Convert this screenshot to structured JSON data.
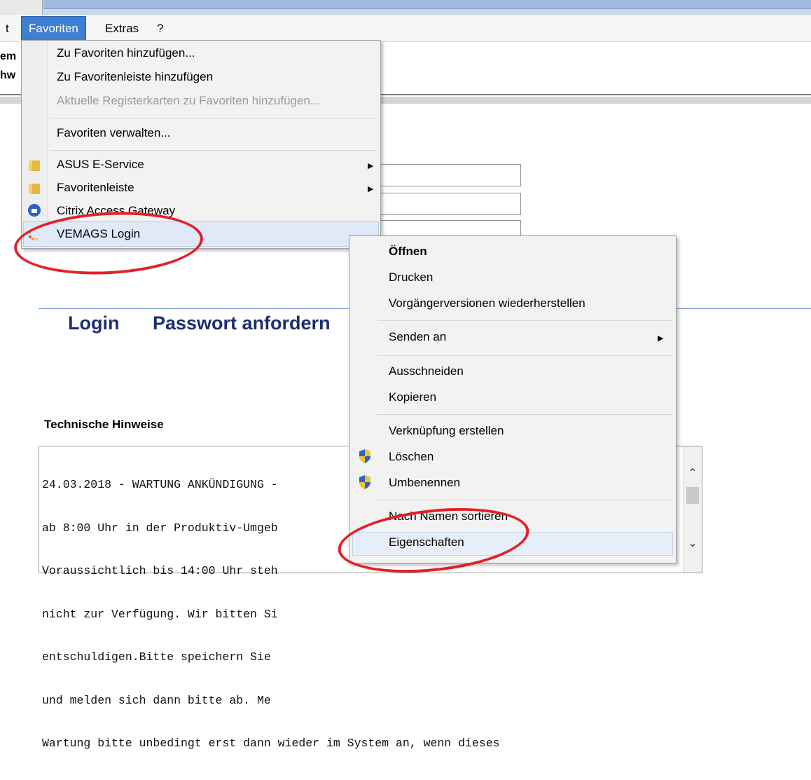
{
  "menubar": {
    "partial_left": "t",
    "items": [
      "Favoriten",
      "Extras",
      "?"
    ]
  },
  "page": {
    "left_fragments": [
      "em",
      "hw"
    ],
    "tabs": [
      "Login",
      "Passwort anfordern"
    ],
    "hinweise_heading": "Technische Hinweise",
    "notice_lines": [
      "24.03.2018 - WARTUNG ANKÜNDIGUNG -",
      "ab 8:00 Uhr in der Produktiv-Umgeb",
      "Voraussichtlich bis 14:00 Uhr steh",
      "nicht zur Verfügung. Wir bitten Si",
      "entschuldigen.Bitte speichern Sie",
      "und melden sich dann bitte ab. Me",
      "Wartung bitte unbedingt erst dann wieder im System an, wenn dieses"
    ]
  },
  "favorites_menu": {
    "items": [
      {
        "label": "Zu Favoriten hinzufügen...",
        "enabled": true
      },
      {
        "label": "Zu Favoritenleiste hinzufügen",
        "enabled": true
      },
      {
        "label": "Aktuelle Registerkarten zu Favoriten hinzufügen...",
        "enabled": false
      },
      {
        "label": "Favoriten verwalten...",
        "enabled": true
      },
      {
        "label": "ASUS E-Service",
        "icon": "folder-icon",
        "submenu": true
      },
      {
        "label": "Favoritenleiste",
        "icon": "folder-icon",
        "submenu": true
      },
      {
        "label": "Citrix Access Gateway",
        "icon": "citrix-icon"
      },
      {
        "label": "VEMAGS Login",
        "icon": "vemags-icon",
        "highlighted": true
      }
    ]
  },
  "context_menu": {
    "items": [
      {
        "label": "Öffnen",
        "bold": true
      },
      {
        "label": "Drucken"
      },
      {
        "label": "Vorgängerversionen wiederherstellen"
      },
      {
        "label": "Senden an",
        "submenu": true
      },
      {
        "label": "Ausschneiden"
      },
      {
        "label": "Kopieren"
      },
      {
        "label": "Verknüpfung erstellen"
      },
      {
        "label": "Löschen",
        "icon": "uac-shield-icon"
      },
      {
        "label": "Umbenennen",
        "icon": "uac-shield-icon"
      },
      {
        "label": "Nach Namen sortieren"
      },
      {
        "label": "Eigenschaften",
        "highlighted": true
      }
    ]
  },
  "colors": {
    "menu_highlight": "#3c7fd4",
    "annotation_red": "#e3202a",
    "heading_blue": "#1e2e6e"
  }
}
